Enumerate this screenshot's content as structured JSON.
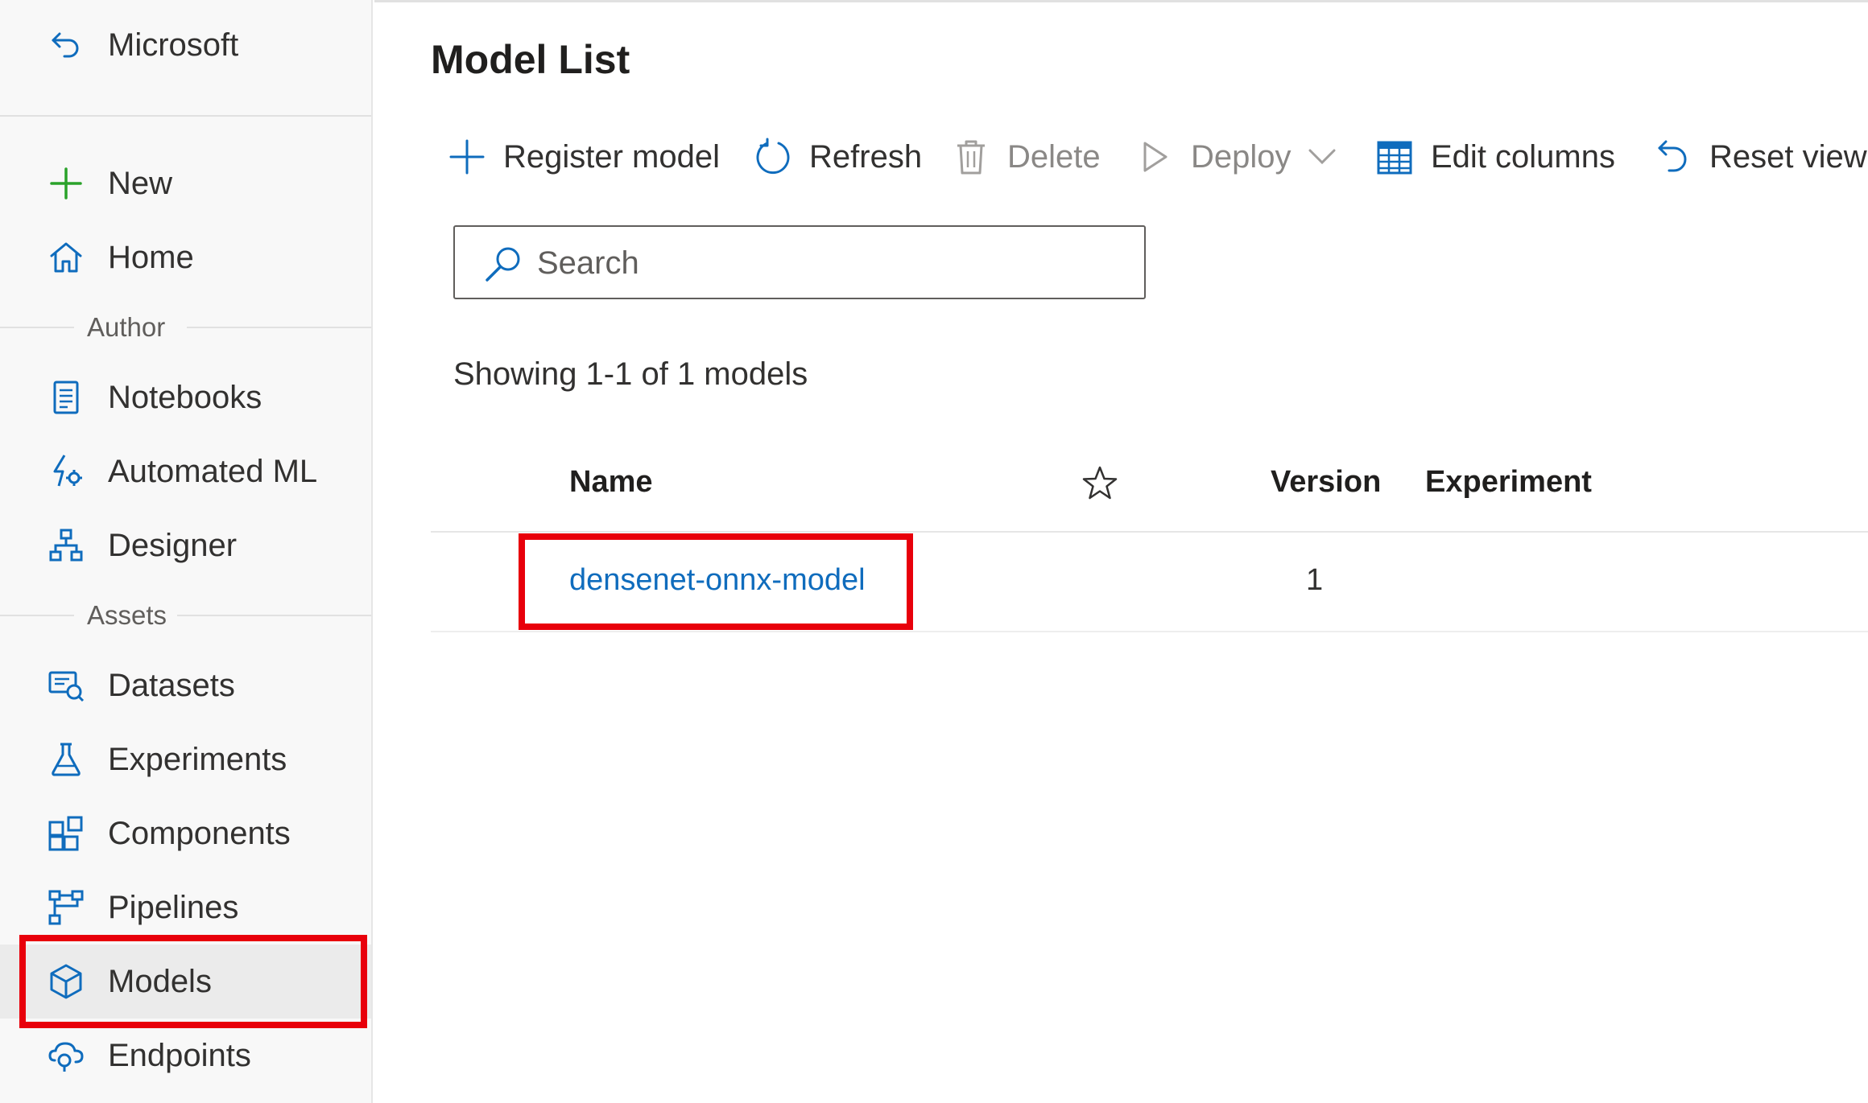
{
  "sidebar": {
    "back_label": "Microsoft",
    "items_top": [
      {
        "label": "New",
        "icon": "plus-icon"
      },
      {
        "label": "Home",
        "icon": "home-icon"
      }
    ],
    "author_section": "Author",
    "items_author": [
      {
        "label": "Notebooks",
        "icon": "notebook-icon"
      },
      {
        "label": "Automated ML",
        "icon": "automl-icon"
      },
      {
        "label": "Designer",
        "icon": "designer-icon"
      }
    ],
    "assets_section": "Assets",
    "items_assets": [
      {
        "label": "Datasets",
        "icon": "dataset-icon"
      },
      {
        "label": "Experiments",
        "icon": "flask-icon"
      },
      {
        "label": "Components",
        "icon": "components-icon"
      },
      {
        "label": "Pipelines",
        "icon": "pipeline-icon"
      },
      {
        "label": "Models",
        "icon": "cube-icon",
        "active": true
      },
      {
        "label": "Endpoints",
        "icon": "endpoint-icon"
      }
    ]
  },
  "main": {
    "title": "Model List",
    "toolbar": {
      "register": "Register model",
      "refresh": "Refresh",
      "delete": "Delete",
      "deploy": "Deploy",
      "edit_columns": "Edit columns",
      "reset_view": "Reset view"
    },
    "search": {
      "placeholder": "Search"
    },
    "showing": "Showing 1-1 of 1 models",
    "table": {
      "columns": {
        "name": "Name",
        "version": "Version",
        "experiment": "Experiment"
      },
      "rows": [
        {
          "name": "densenet-onnx-model",
          "version": "1",
          "experiment": ""
        }
      ]
    }
  },
  "colors": {
    "accent": "#0f6cbd",
    "highlight": "#e8000b",
    "new_icon": "#2aa22a"
  }
}
